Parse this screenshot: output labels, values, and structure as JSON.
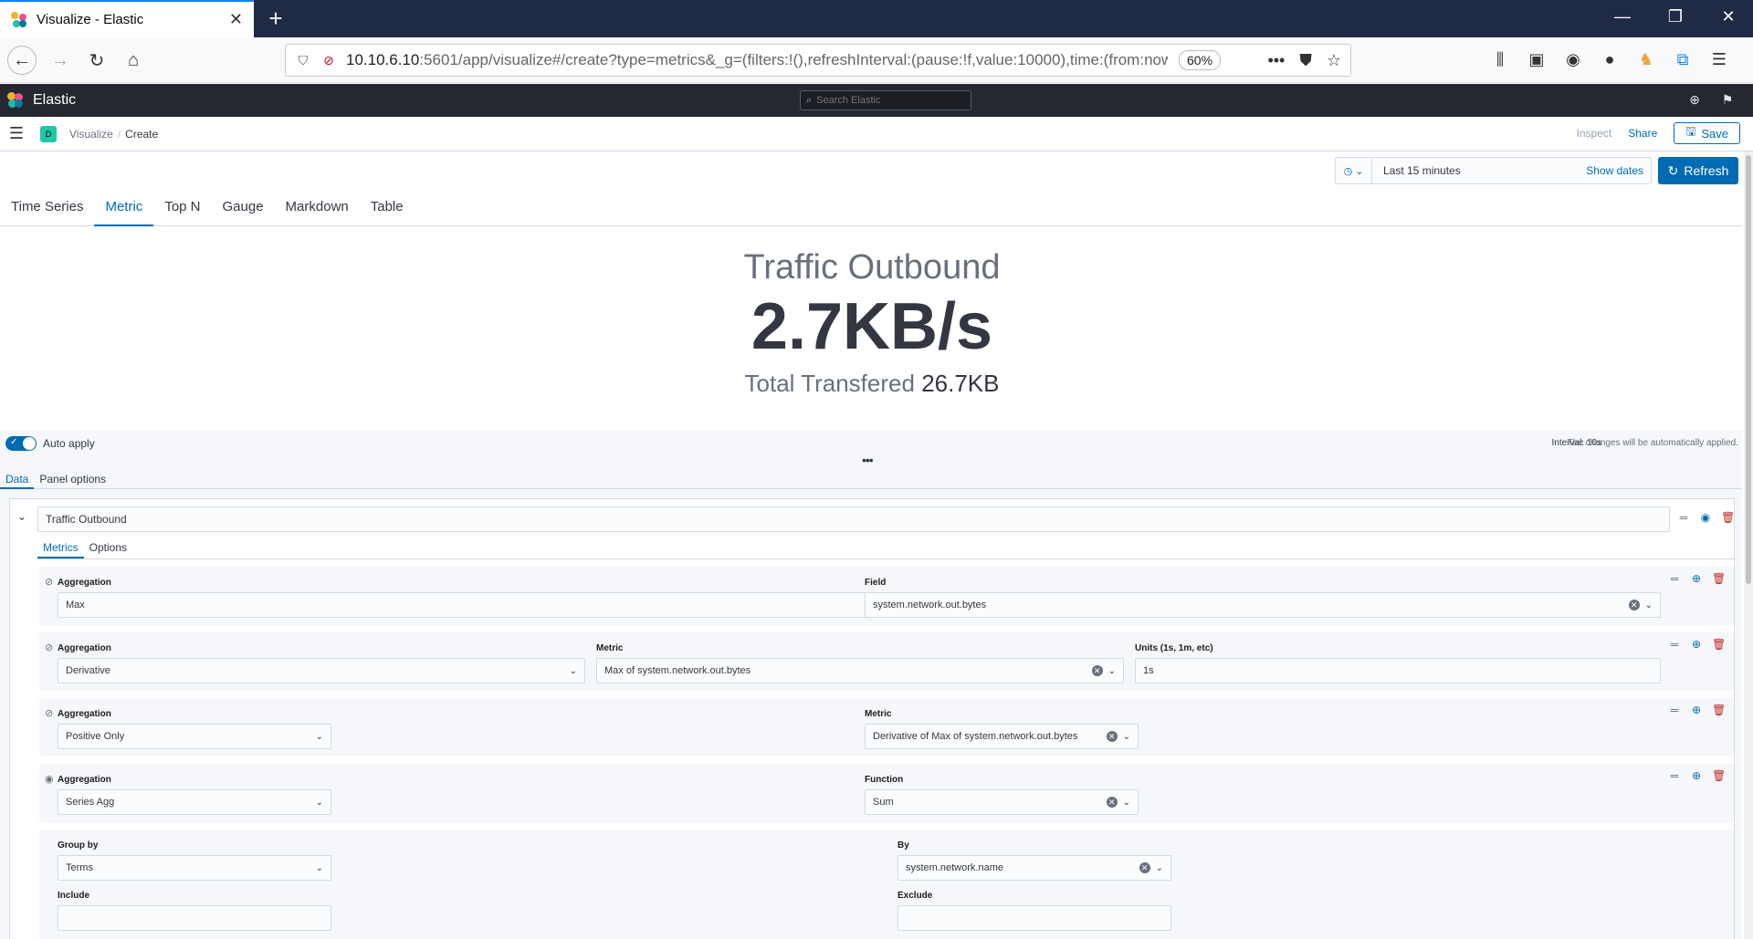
{
  "browser": {
    "tab_title": "Visualize - Elastic",
    "url_host": "10.10.6.10",
    "url_rest": ":5601/app/visualize#/create?type=metrics&_g=(filters:!(),refreshInterval:(pause:!f,value:10000),time:(from:now",
    "zoom": "60%"
  },
  "kibana": {
    "brand": "Elastic",
    "search_placeholder": "Search Elastic",
    "space_initial": "D",
    "breadcrumbs": [
      "Visualize",
      "Create"
    ],
    "inspect": "Inspect",
    "share": "Share",
    "save": "Save"
  },
  "time": {
    "label": "Last 15 minutes",
    "show_dates": "Show dates",
    "refresh": "Refresh"
  },
  "vis_tabs": [
    "Time Series",
    "Metric",
    "Top N",
    "Gauge",
    "Markdown",
    "Table"
  ],
  "metric": {
    "title": "Traffic Outbound",
    "value": "2.7KB/s",
    "sub_label": "Total Transfered",
    "sub_value": "26.7KB"
  },
  "editor": {
    "auto_apply": "Auto apply",
    "interval": "Interval: 10s",
    "note": "The changes will be automatically applied.",
    "tabs": [
      "Data",
      "Panel options"
    ],
    "series_label": "Traffic Outbound",
    "series_tabs": [
      "Metrics",
      "Options"
    ],
    "rows": [
      {
        "agg_label": "Aggregation",
        "agg": "Max",
        "f2_label": "Field",
        "f2": "system.network.out.bytes"
      },
      {
        "agg_label": "Aggregation",
        "agg": "Derivative",
        "f2_label": "Metric",
        "f2": "Max of system.network.out.bytes",
        "f3_label": "Units (1s, 1m, etc)",
        "f3": "1s"
      },
      {
        "agg_label": "Aggregation",
        "agg": "Positive Only",
        "f2_label": "Metric",
        "f2": "Derivative of Max of system.network.out.bytes"
      },
      {
        "agg_label": "Aggregation",
        "agg": "Series Agg",
        "f2_label": "Function",
        "f2": "Sum"
      }
    ],
    "group_by_label": "Group by",
    "group_by": "Terms",
    "by_label": "By",
    "by": "system.network.name",
    "include_label": "Include",
    "exclude_label": "Exclude"
  },
  "colors": {
    "accent": "#006bb4",
    "header": "#25282f",
    "danger": "#bd271e"
  }
}
